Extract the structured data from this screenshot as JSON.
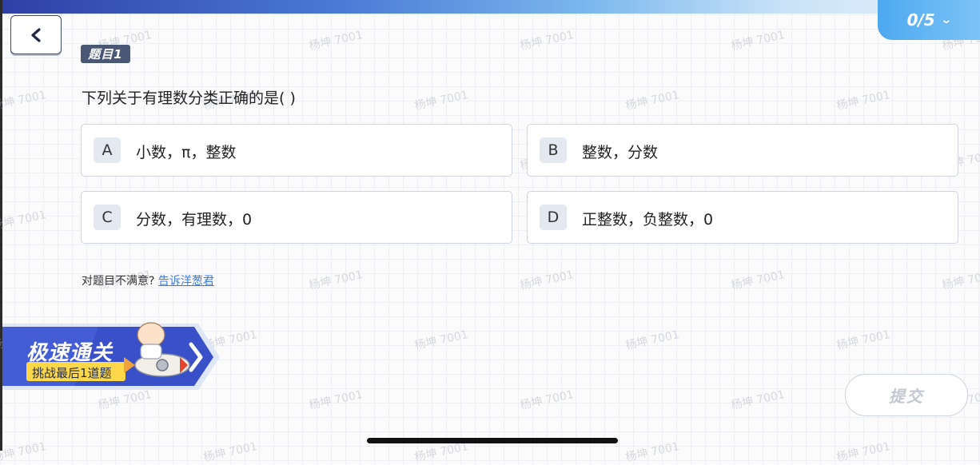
{
  "progress": {
    "text": "0/5"
  },
  "question": {
    "badge": "题目1",
    "text": "下列关于有理数分类正确的是(   )",
    "options": [
      {
        "letter": "A",
        "text": "小数，π，整数"
      },
      {
        "letter": "B",
        "text": "整数，分数"
      },
      {
        "letter": "C",
        "text": "分数，有理数，0"
      },
      {
        "letter": "D",
        "text": "正整数，负整数，0"
      }
    ]
  },
  "feedback": {
    "prompt": "对题目不满意?",
    "link": "告诉洋葱君"
  },
  "banner": {
    "title": "极速通关",
    "subtitle": "挑战最后1道题"
  },
  "submit": {
    "label": "提交"
  },
  "watermark": "杨坤 7001",
  "colors": {
    "accent": "#4da8f0",
    "link": "#3b7be0",
    "badge": "#4a5775",
    "banner": "#3a50c8",
    "banner_sub": "#ffd84a"
  }
}
